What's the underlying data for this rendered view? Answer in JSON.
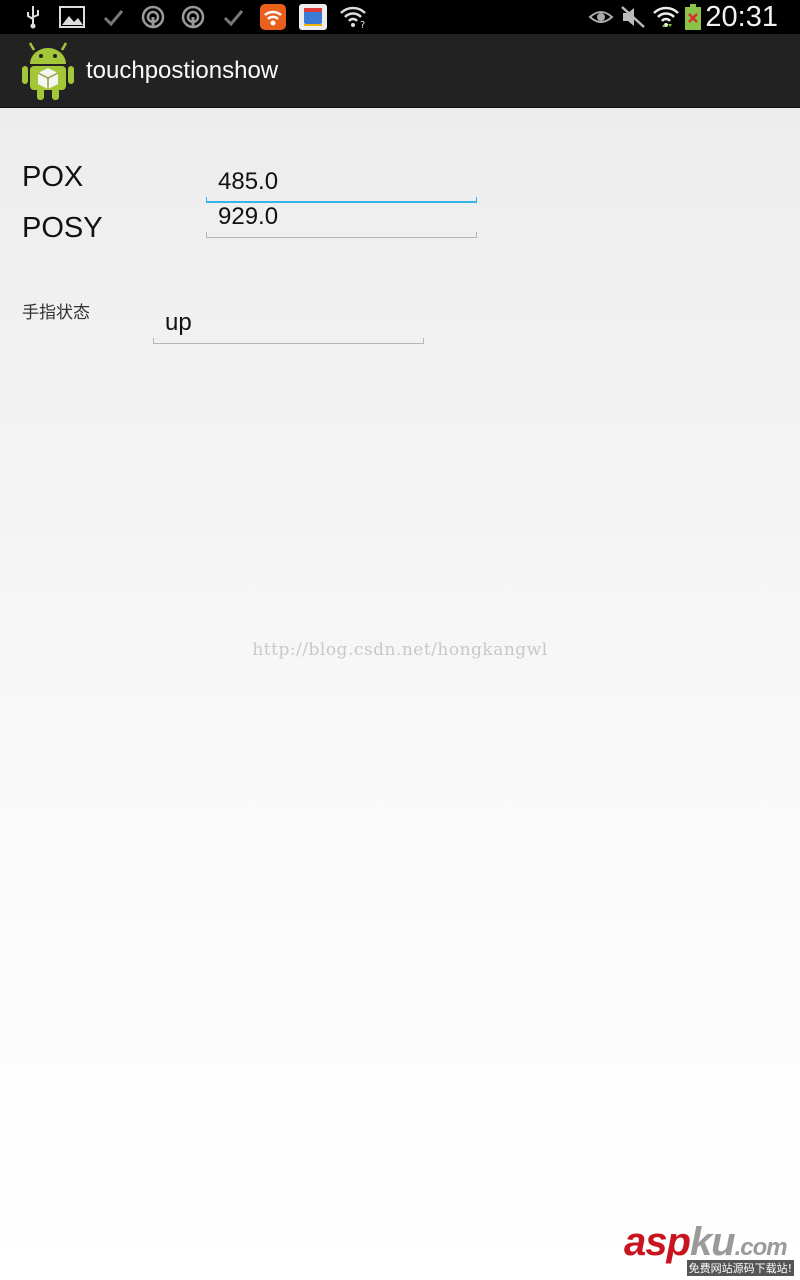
{
  "status_bar": {
    "time": "20:31",
    "left_icons": [
      "usb-icon",
      "image-icon",
      "check-icon",
      "podcast-icon",
      "podcast-icon",
      "check-icon",
      "rss-app-icon",
      "store-app-icon",
      "wifi-notify-icon"
    ],
    "right_icons": [
      "eye-icon",
      "mute-icon",
      "wifi-icon",
      "battery-icon"
    ]
  },
  "action_bar": {
    "title": "touchpostionshow",
    "icon": "android-icon"
  },
  "form": {
    "pox_label": "POX",
    "pox_value": "485.0",
    "posy_label": "POSY",
    "posy_value": "929.0",
    "finger_state_label": "手指状态",
    "finger_state_value": "up"
  },
  "watermark": "http://blog.csdn.net/hongkangwl",
  "brand": {
    "part1": "asp",
    "part2": "ku",
    "part3": ".com",
    "tagline": "免费网站源码下载站!"
  },
  "colors": {
    "focus_accent": "#33b5e5",
    "brand_red": "#c8141e"
  }
}
